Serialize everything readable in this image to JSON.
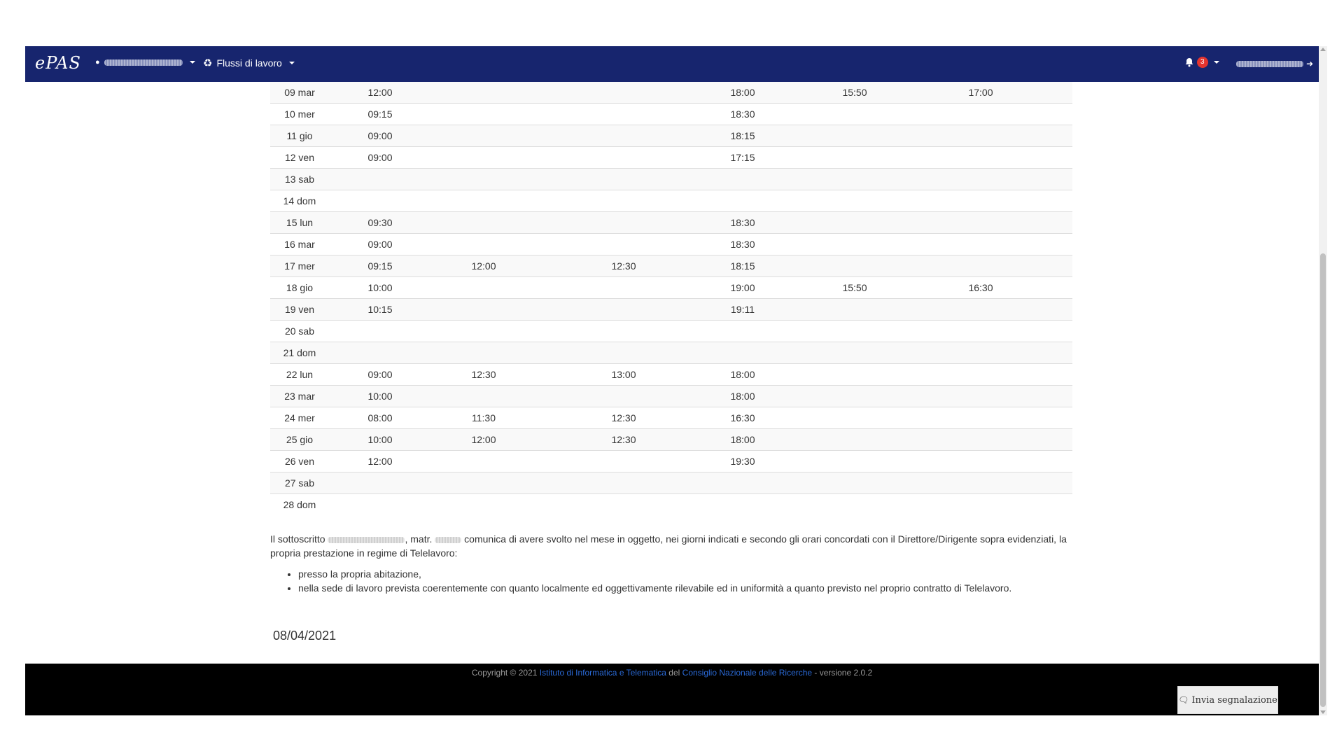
{
  "navbar": {
    "brand": "ePAS",
    "workflows_label": "Flussi di lavoro",
    "notifications_count": "3",
    "colors": {
      "background": "#17256e",
      "badge": "#e3342f"
    }
  },
  "timesheet": {
    "rows": [
      {
        "day": "09 mar",
        "t1": "12:00",
        "t2": "",
        "t3": "",
        "t4": "18:00",
        "t5": "15:50",
        "t6": "17:00"
      },
      {
        "day": "10 mer",
        "t1": "09:15",
        "t2": "",
        "t3": "",
        "t4": "18:30",
        "t5": "",
        "t6": ""
      },
      {
        "day": "11 gio",
        "t1": "09:00",
        "t2": "",
        "t3": "",
        "t4": "18:15",
        "t5": "",
        "t6": ""
      },
      {
        "day": "12 ven",
        "t1": "09:00",
        "t2": "",
        "t3": "",
        "t4": "17:15",
        "t5": "",
        "t6": ""
      },
      {
        "day": "13 sab",
        "t1": "",
        "t2": "",
        "t3": "",
        "t4": "",
        "t5": "",
        "t6": ""
      },
      {
        "day": "14 dom",
        "t1": "",
        "t2": "",
        "t3": "",
        "t4": "",
        "t5": "",
        "t6": ""
      },
      {
        "day": "15 lun",
        "t1": "09:30",
        "t2": "",
        "t3": "",
        "t4": "18:30",
        "t5": "",
        "t6": ""
      },
      {
        "day": "16 mar",
        "t1": "09:00",
        "t2": "",
        "t3": "",
        "t4": "18:30",
        "t5": "",
        "t6": ""
      },
      {
        "day": "17 mer",
        "t1": "09:15",
        "t2": "12:00",
        "t3": "12:30",
        "t4": "18:15",
        "t5": "",
        "t6": ""
      },
      {
        "day": "18 gio",
        "t1": "10:00",
        "t2": "",
        "t3": "",
        "t4": "19:00",
        "t5": "15:50",
        "t6": "16:30"
      },
      {
        "day": "19 ven",
        "t1": "10:15",
        "t2": "",
        "t3": "",
        "t4": "19:11",
        "t5": "",
        "t6": ""
      },
      {
        "day": "20 sab",
        "t1": "",
        "t2": "",
        "t3": "",
        "t4": "",
        "t5": "",
        "t6": ""
      },
      {
        "day": "21 dom",
        "t1": "",
        "t2": "",
        "t3": "",
        "t4": "",
        "t5": "",
        "t6": ""
      },
      {
        "day": "22 lun",
        "t1": "09:00",
        "t2": "12:30",
        "t3": "13:00",
        "t4": "18:00",
        "t5": "",
        "t6": ""
      },
      {
        "day": "23 mar",
        "t1": "10:00",
        "t2": "",
        "t3": "",
        "t4": "18:00",
        "t5": "",
        "t6": ""
      },
      {
        "day": "24 mer",
        "t1": "08:00",
        "t2": "11:30",
        "t3": "12:30",
        "t4": "16:30",
        "t5": "",
        "t6": ""
      },
      {
        "day": "25 gio",
        "t1": "10:00",
        "t2": "12:00",
        "t3": "12:30",
        "t4": "18:00",
        "t5": "",
        "t6": ""
      },
      {
        "day": "26 ven",
        "t1": "12:00",
        "t2": "",
        "t3": "",
        "t4": "19:30",
        "t5": "",
        "t6": ""
      },
      {
        "day": "27 sab",
        "t1": "",
        "t2": "",
        "t3": "",
        "t4": "",
        "t5": "",
        "t6": ""
      },
      {
        "day": "28 dom",
        "t1": "",
        "t2": "",
        "t3": "",
        "t4": "",
        "t5": "",
        "t6": ""
      }
    ]
  },
  "declaration": {
    "part1": "Il sottoscritto",
    "part2": ", matr.",
    "part3": "comunica di avere svolto nel mese in oggetto, nei giorni indicati e secondo gli orari concordati con il Direttore/Dirigente sopra evidenziati, la propria prestazione in regime di Telelavoro:",
    "items": [
      "presso la propria abitazione,",
      "nella sede di lavoro prevista coerentemente con quanto localmente ed oggettivamente rilevabile ed in uniformità a quanto previsto nel proprio contratto di Telelavoro."
    ]
  },
  "date": "08/04/2021",
  "footer": {
    "copyright_prefix": "Copyright © 2021 ",
    "institute_link": "Istituto di Informatica e Telematica",
    "middle": " del ",
    "cnr_link": "Consiglio Nazionale delle Ricerche",
    "version": " - versione 2.0.2",
    "report_button": "Invia segnalazione"
  }
}
